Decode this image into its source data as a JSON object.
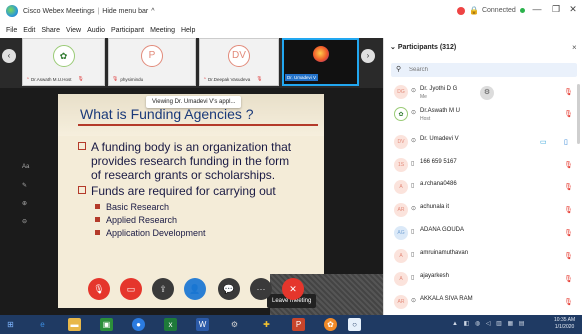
{
  "window": {
    "title": "Cisco Webex Meetings",
    "hide_menu": "Hide menu bar",
    "connection": "Connected",
    "minimize": "—",
    "restore": "❐",
    "close": "✕"
  },
  "menu": [
    "File",
    "Edit",
    "Share",
    "View",
    "Audio",
    "Participant",
    "Meeting",
    "Help"
  ],
  "thumbnails": [
    {
      "name": "Dr.Aswath M.U.Host",
      "avatar": "logo"
    },
    {
      "name": "physimindu",
      "avatar": "P"
    },
    {
      "name": "Dr.Deepak Vasudeva",
      "avatar": "DV"
    },
    {
      "name": "Dr. Umadevi V",
      "avatar": "logo2"
    }
  ],
  "slide": {
    "viewing": "Viewing Dr. Umadevi V's appl...",
    "title": "What is Funding Agencies ?",
    "bullets": [
      "A funding body is an organization that",
      "provides research funding in the form",
      "of research grants or scholarships.",
      "Funds are required for carrying out"
    ],
    "subitems": [
      "Basic Research",
      "Applied Research",
      "Application Development"
    ],
    "side_marks": [
      "Aa",
      "✎",
      "⊕",
      "⊖"
    ]
  },
  "tooltip": "Leave meeting",
  "controls": [
    "🎙",
    "▭",
    "⇪",
    "👤",
    "💬",
    "···",
    "✕"
  ],
  "participants": {
    "header": "Participants (312)",
    "search_placeholder": "Search",
    "list": [
      {
        "initials": "DG",
        "name": "Dr. Jyothi D G",
        "role": "Me",
        "mic": "red"
      },
      {
        "initials": "DA",
        "name": "Dr.Aswath M U",
        "role": "Host",
        "mic": "red",
        "logo": true
      },
      {
        "initials": "DV",
        "name": "Dr. Umadevi V",
        "role": "",
        "mic": "blue"
      },
      {
        "initials": "1S",
        "name": "166 659 5167",
        "role": "",
        "mic": "red"
      },
      {
        "initials": "A",
        "name": "a.rchana0486",
        "role": "",
        "mic": "red"
      },
      {
        "initials": "AR",
        "name": "achunala it",
        "role": "",
        "mic": "red"
      },
      {
        "initials": "AG",
        "name": "ADANA GOUDA",
        "role": "",
        "mic": "red"
      },
      {
        "initials": "A",
        "name": "amruinamuthavan",
        "role": "",
        "mic": "red"
      },
      {
        "initials": "A",
        "name": "ajayarkesh",
        "role": "",
        "mic": "red"
      },
      {
        "initials": "AR",
        "name": "AKKALA SIVA RAM",
        "role": "",
        "mic": "red"
      }
    ]
  },
  "taskbar": {
    "clock_time": "10:35 AM",
    "clock_date": "1/1/2020"
  }
}
